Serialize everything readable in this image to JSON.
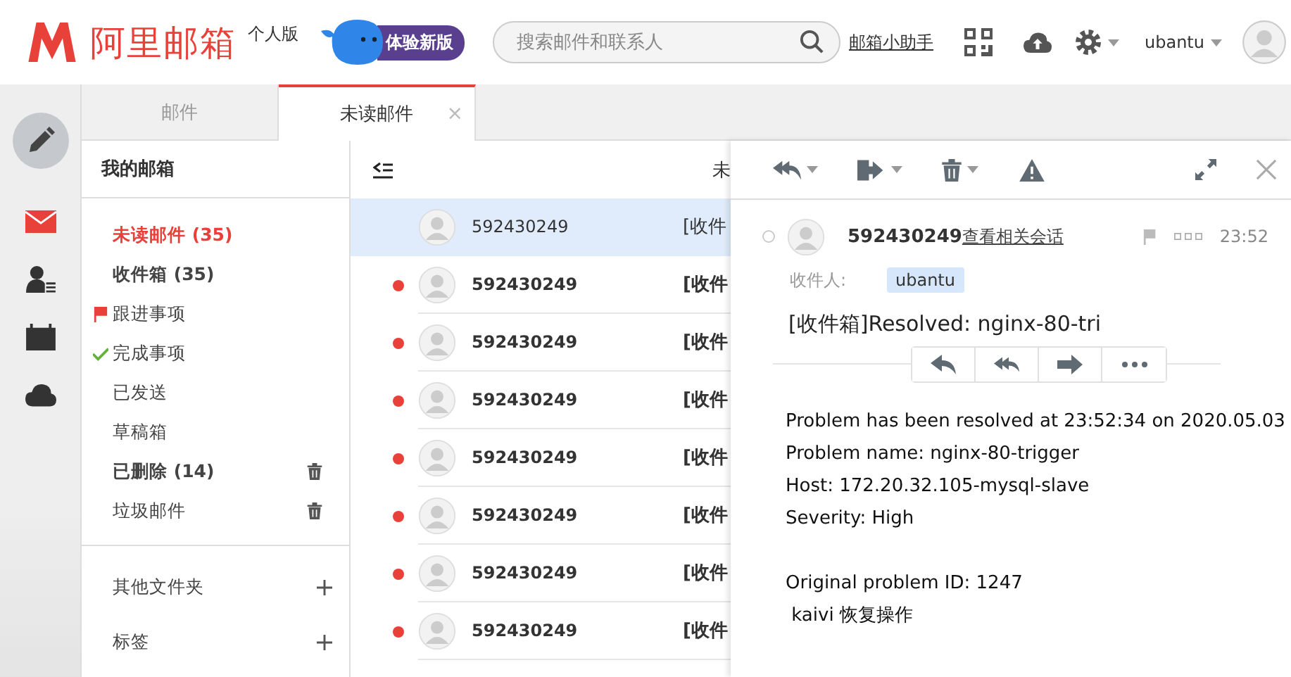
{
  "header": {
    "logo_text": "阿里邮箱",
    "edition": "个人版",
    "new_version_badge": "体验新版",
    "search": {
      "placeholder": "搜索邮件和联系人"
    },
    "assistant_link": "邮箱小助手",
    "user": "ubantu"
  },
  "rail": [
    {
      "kind": "compose",
      "selected": false
    },
    {
      "kind": "mail",
      "selected": true
    },
    {
      "kind": "contacts",
      "selected": false
    },
    {
      "kind": "calendar",
      "selected": false
    },
    {
      "kind": "cloud",
      "selected": false
    }
  ],
  "tabs": [
    {
      "label": "邮件",
      "selected": false
    },
    {
      "label": "未读邮件",
      "selected": true,
      "close": "×"
    }
  ],
  "folders": {
    "title": "我的邮箱",
    "items": [
      {
        "kind": "plain",
        "label": "未读邮件 (35)",
        "selected": true,
        "bold": true,
        "deletable": false
      },
      {
        "kind": "plain",
        "label": "收件箱 (35)",
        "selected": false,
        "bold": true,
        "deletable": false
      },
      {
        "kind": "flag",
        "label": "跟进事项",
        "selected": false,
        "bold": false,
        "deletable": false
      },
      {
        "kind": "check",
        "label": "完成事项",
        "selected": false,
        "bold": false,
        "deletable": false
      },
      {
        "kind": "plain",
        "label": "已发送",
        "selected": false,
        "bold": false,
        "deletable": false
      },
      {
        "kind": "plain",
        "label": "草稿箱",
        "selected": false,
        "bold": false,
        "deletable": false
      },
      {
        "kind": "plain",
        "label": "已删除 (14)",
        "selected": false,
        "bold": true,
        "deletable": true
      },
      {
        "kind": "plain",
        "label": "垃圾邮件",
        "selected": false,
        "bold": false,
        "deletable": true
      }
    ],
    "sections": [
      "其他文件夹",
      "标签"
    ]
  },
  "list": {
    "title": "未",
    "rows": [
      {
        "sender": "592430249",
        "subject": "[收件",
        "unread": false,
        "selected": true
      },
      {
        "sender": "592430249",
        "subject": "[收件",
        "unread": true,
        "selected": false
      },
      {
        "sender": "592430249",
        "subject": "[收件",
        "unread": true,
        "selected": false
      },
      {
        "sender": "592430249",
        "subject": "[收件",
        "unread": true,
        "selected": false
      },
      {
        "sender": "592430249",
        "subject": "[收件",
        "unread": true,
        "selected": false
      },
      {
        "sender": "592430249",
        "subject": "[收件",
        "unread": true,
        "selected": false
      },
      {
        "sender": "592430249",
        "subject": "[收件",
        "unread": true,
        "selected": false
      },
      {
        "sender": "592430249",
        "subject": "[收件",
        "unread": true,
        "selected": false
      }
    ]
  },
  "reader": {
    "sender": "592430249",
    "conversation_link": "查看相关会话",
    "time": "23:52",
    "recipient_label": "收件人:",
    "recipients": [
      "ubantu"
    ],
    "subject": "[收件箱]Resolved: nginx-80-tri",
    "body": [
      [
        "Problem has been resolved at 23:52:34 on 2020.05.03",
        "Problem name: nginx-80-trigger",
        "Host: 172.20.32.105-mysql-slave",
        "Severity: High"
      ],
      [
        "Original problem ID: 1247",
        " kaivi 恢复操作"
      ]
    ]
  }
}
